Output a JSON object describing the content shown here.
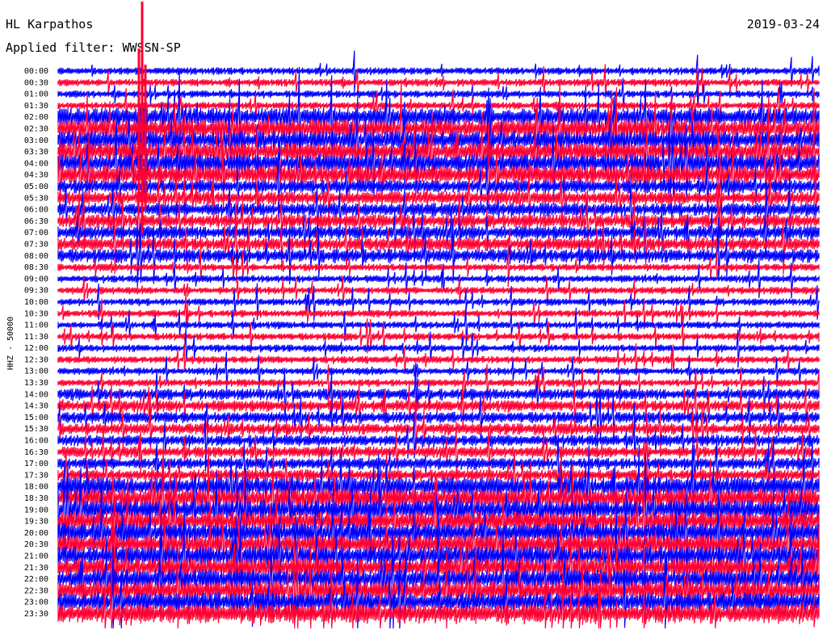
{
  "header": {
    "station": "HL Karpathos",
    "filter": "Applied filter: WWSSN-SP",
    "date": "2019-03-24"
  },
  "chart_data": {
    "type": "line",
    "title": "HL Karpathos",
    "subtitle": "Applied filter: WWSSN-SP",
    "ylabel": "HHZ - 50000",
    "rows": [
      "00:00",
      "00:30",
      "01:00",
      "01:30",
      "02:00",
      "02:30",
      "03:00",
      "03:30",
      "04:00",
      "04:30",
      "05:00",
      "05:30",
      "06:00",
      "06:30",
      "07:00",
      "07:30",
      "08:00",
      "08:30",
      "09:00",
      "09:30",
      "10:00",
      "10:30",
      "11:00",
      "11:30",
      "12:00",
      "12:30",
      "13:00",
      "13:30",
      "14:00",
      "14:30",
      "15:00",
      "15:30",
      "16:00",
      "16:30",
      "17:00",
      "17:30",
      "18:00",
      "18:30",
      "19:00",
      "19:30",
      "20:00",
      "20:30",
      "21:00",
      "21:30",
      "22:00",
      "22:30",
      "23:00",
      "23:30"
    ],
    "trace_colors": [
      "#0000ff",
      "#ff0033"
    ],
    "grid": false
  }
}
